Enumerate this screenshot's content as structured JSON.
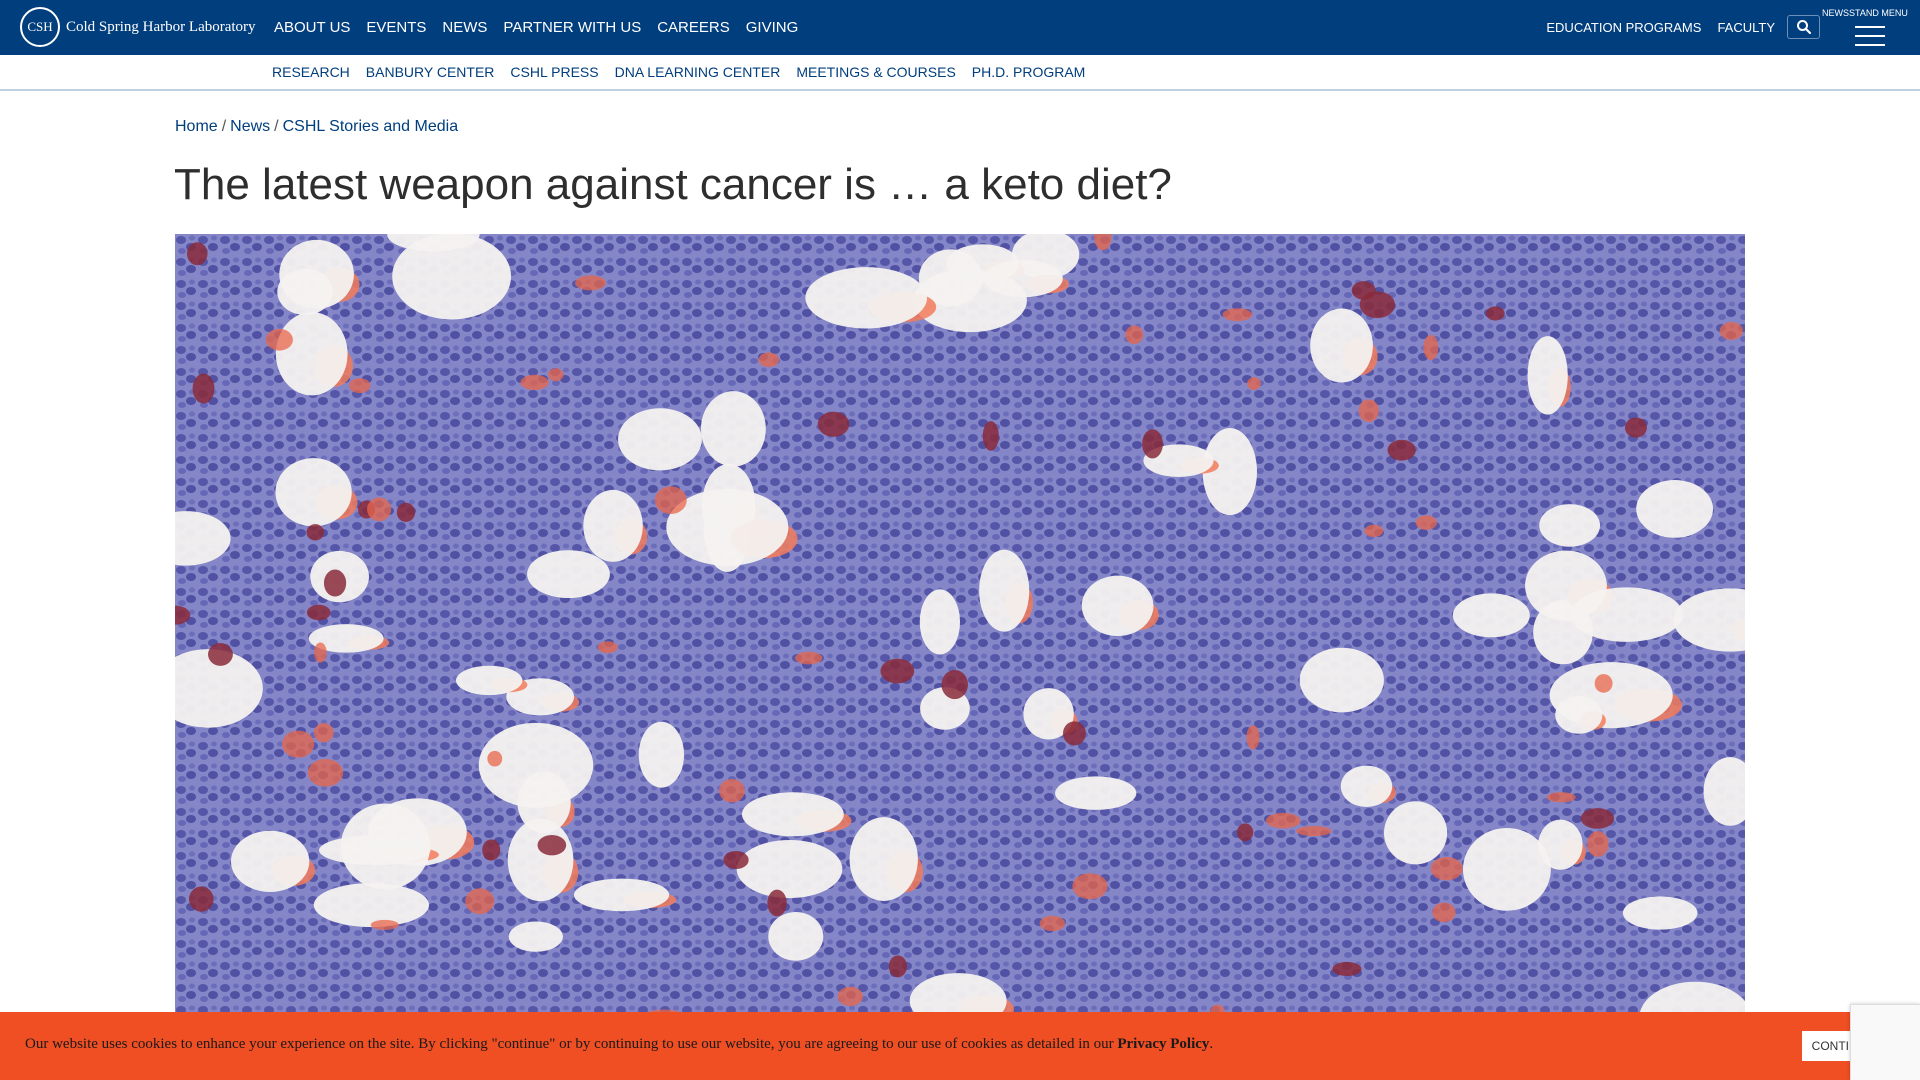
{
  "logo": {
    "seal": "CSH",
    "text": "Cold Spring Harbor Laboratory"
  },
  "main_nav": [
    "ABOUT US",
    "EVENTS",
    "NEWS",
    "PARTNER WITH US",
    "CAREERS",
    "GIVING"
  ],
  "right_nav": [
    "EDUCATION PROGRAMS",
    "FACULTY"
  ],
  "newsstand_label": "NEWSSTAND MENU",
  "sub_nav": [
    "RESEARCH",
    "BANBURY CENTER",
    "CSHL PRESS",
    "DNA LEARNING CENTER",
    "MEETINGS & COURSES",
    "PH.D. PROGRAM"
  ],
  "breadcrumb": [
    "Home",
    "News",
    "CSHL Stories and Media"
  ],
  "article": {
    "title": "The latest weapon against cancer is … a keto diet?"
  },
  "cookie": {
    "text": "Our website uses cookies to enhance your experience on the site. By clicking \"continue\" or by continuing to use our website, you are agreeing to our use of cookies as detailed in our ",
    "link": "Privacy Policy",
    "end": ".",
    "button": "CONTINUE"
  },
  "colors": {
    "brand_blue": "#003e7e",
    "cookie_orange": "#f04e23"
  },
  "icons": {
    "search": "search-icon",
    "menu": "hamburger-icon"
  }
}
